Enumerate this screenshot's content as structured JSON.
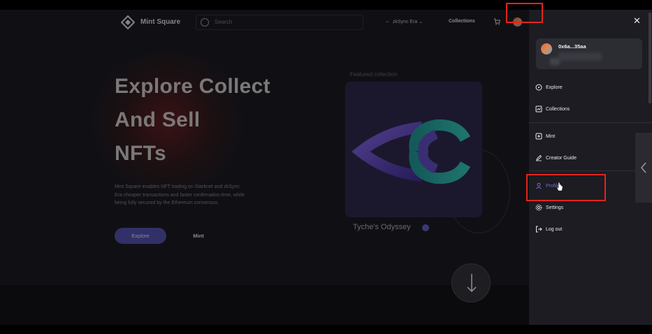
{
  "nav": {
    "logo_text": "Mint Square",
    "search_placeholder": "Search",
    "network_label": "zkSync Era",
    "collections_label": "Collections"
  },
  "hero": {
    "title_line1": "Explore Collect",
    "title_line2": "And Sell",
    "title_line3": "NFTs",
    "description": "Mint Square enables NFT trading on Starknet and zkSync Era cheaper transactions and faster confirmation time, while being fully secured by the Ethereum consensus.",
    "explore_label": "Explore",
    "mint_label": "Mint"
  },
  "featured": {
    "label": "Featured collection",
    "name": "Tyche's Odyssey"
  },
  "drawer": {
    "address": "0x6a...35aa",
    "menu": [
      {
        "label": "Explore",
        "icon": "compass-icon"
      },
      {
        "label": "Collections",
        "icon": "collection-icon"
      },
      {
        "label": "Mint",
        "icon": "plus-square-icon"
      },
      {
        "label": "Creator Guide",
        "icon": "pen-icon"
      },
      {
        "label": "Profile",
        "icon": "user-icon"
      },
      {
        "label": "Settings",
        "icon": "gear-icon"
      },
      {
        "label": "Log out",
        "icon": "logout-icon"
      }
    ]
  },
  "colors": {
    "accent": "#6e6ae0",
    "highlight_box": "#e4241c",
    "explore_button": "#4d4aa0"
  }
}
